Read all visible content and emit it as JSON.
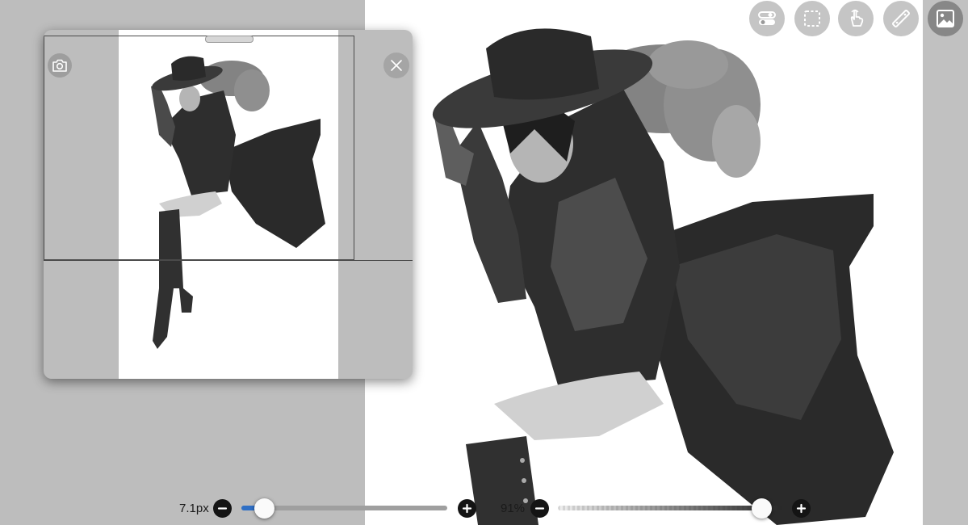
{
  "colors": {
    "background": "#bdbdbd",
    "paper": "#ffffff",
    "accent_blue": "#2f6fc5",
    "button_dark": "#141414"
  },
  "toolbar": {
    "tools": [
      {
        "icon": "toggle-settings-icon",
        "active": false
      },
      {
        "icon": "selection-marquee-icon",
        "active": false
      },
      {
        "icon": "hand-gesture-icon",
        "active": false
      },
      {
        "icon": "ruler-icon",
        "active": false
      },
      {
        "icon": "image-layer-icon",
        "active": true
      }
    ]
  },
  "navigator": {
    "camera_icon": "camera-icon",
    "close_icon": "close-icon"
  },
  "brush_size": {
    "label": "7.1px",
    "fraction": 0.11,
    "minus_icon": "minus-icon",
    "plus_icon": "plus-icon"
  },
  "opacity": {
    "label": "91%",
    "fraction": 0.91,
    "minus_icon": "minus-icon",
    "plus_icon": "plus-icon"
  }
}
